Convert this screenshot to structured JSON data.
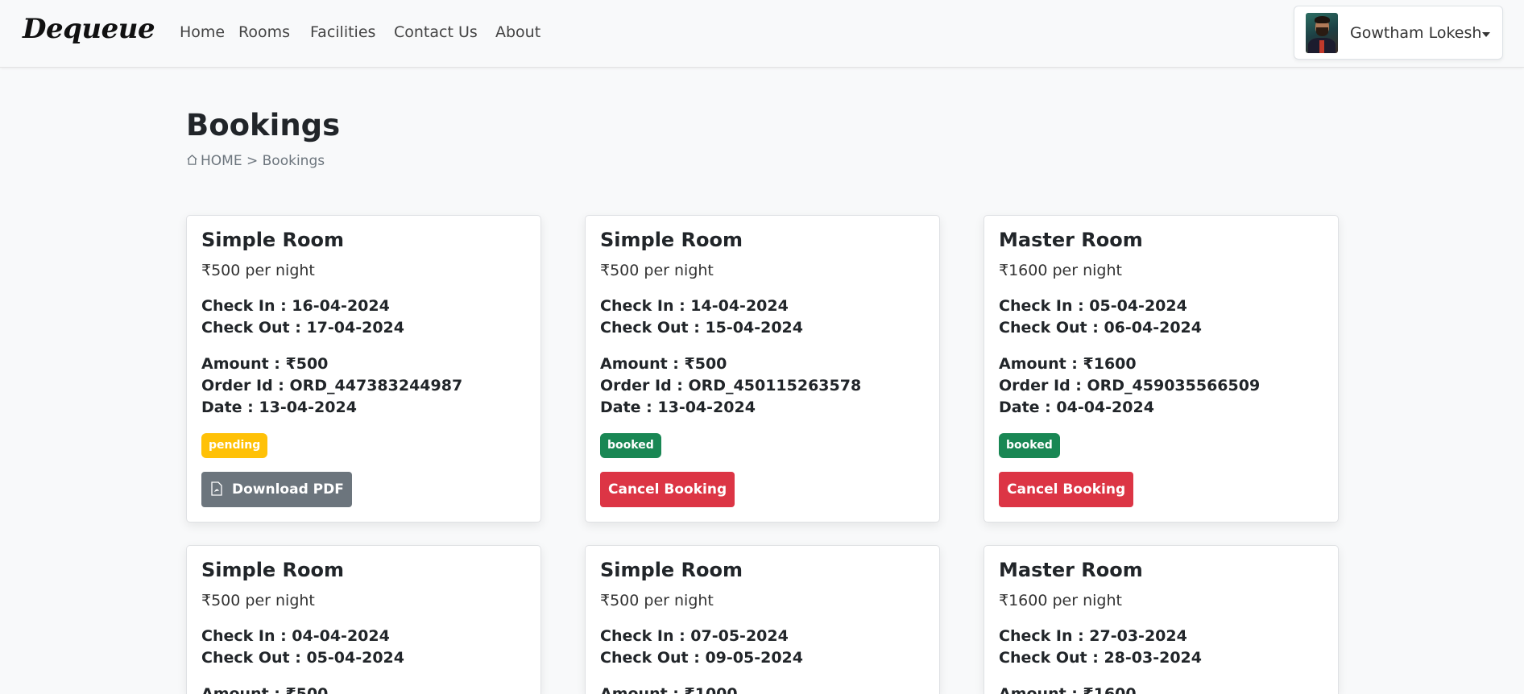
{
  "brand": "Dequeue",
  "nav": {
    "home": "Home",
    "rooms": "Rooms",
    "facilities": "Facilities",
    "contact": "Contact Us",
    "about": "About"
  },
  "user": {
    "name": "Gowtham Lokesh"
  },
  "page": {
    "title": "Bookings",
    "breadcrumb": {
      "home": "HOME",
      "separator": ">",
      "current": "Bookings"
    }
  },
  "bookings": [
    {
      "room": "Simple Room",
      "price": "₹500 per night",
      "check_in": "Check In : 16-04-2024",
      "check_out": "Check Out : 17-04-2024",
      "amount": "Amount : ₹500",
      "order_id": "Order Id : ORD_447383244987",
      "date": "Date : 13-04-2024",
      "status": "pending",
      "action": "Download PDF"
    },
    {
      "room": "Simple Room",
      "price": "₹500 per night",
      "check_in": "Check In : 14-04-2024",
      "check_out": "Check Out : 15-04-2024",
      "amount": "Amount : ₹500",
      "order_id": "Order Id : ORD_450115263578",
      "date": "Date : 13-04-2024",
      "status": "booked",
      "action": "Cancel Booking"
    },
    {
      "room": "Master Room",
      "price": "₹1600 per night",
      "check_in": "Check In : 05-04-2024",
      "check_out": "Check Out : 06-04-2024",
      "amount": "Amount : ₹1600",
      "order_id": "Order Id : ORD_459035566509",
      "date": "Date : 04-04-2024",
      "status": "booked",
      "action": "Cancel Booking"
    },
    {
      "room": "Simple Room",
      "price": "₹500 per night",
      "check_in": "Check In : 04-04-2024",
      "check_out": "Check Out : 05-04-2024",
      "amount": "Amount : ₹500"
    },
    {
      "room": "Simple Room",
      "price": "₹500 per night",
      "check_in": "Check In : 07-05-2024",
      "check_out": "Check Out : 09-05-2024",
      "amount": "Amount : ₹1000"
    },
    {
      "room": "Master Room",
      "price": "₹1600 per night",
      "check_in": "Check In : 27-03-2024",
      "check_out": "Check Out : 28-03-2024",
      "amount": "Amount : ₹1600"
    }
  ],
  "colors": {
    "pending": "#ffc107",
    "booked": "#198754",
    "danger": "#dc3545",
    "secondary": "#6c757d"
  },
  "icons": {
    "breadcrumb_home": "home-icon",
    "pdf": "file-pdf-icon",
    "user_menu": "chevron-down-icon"
  }
}
